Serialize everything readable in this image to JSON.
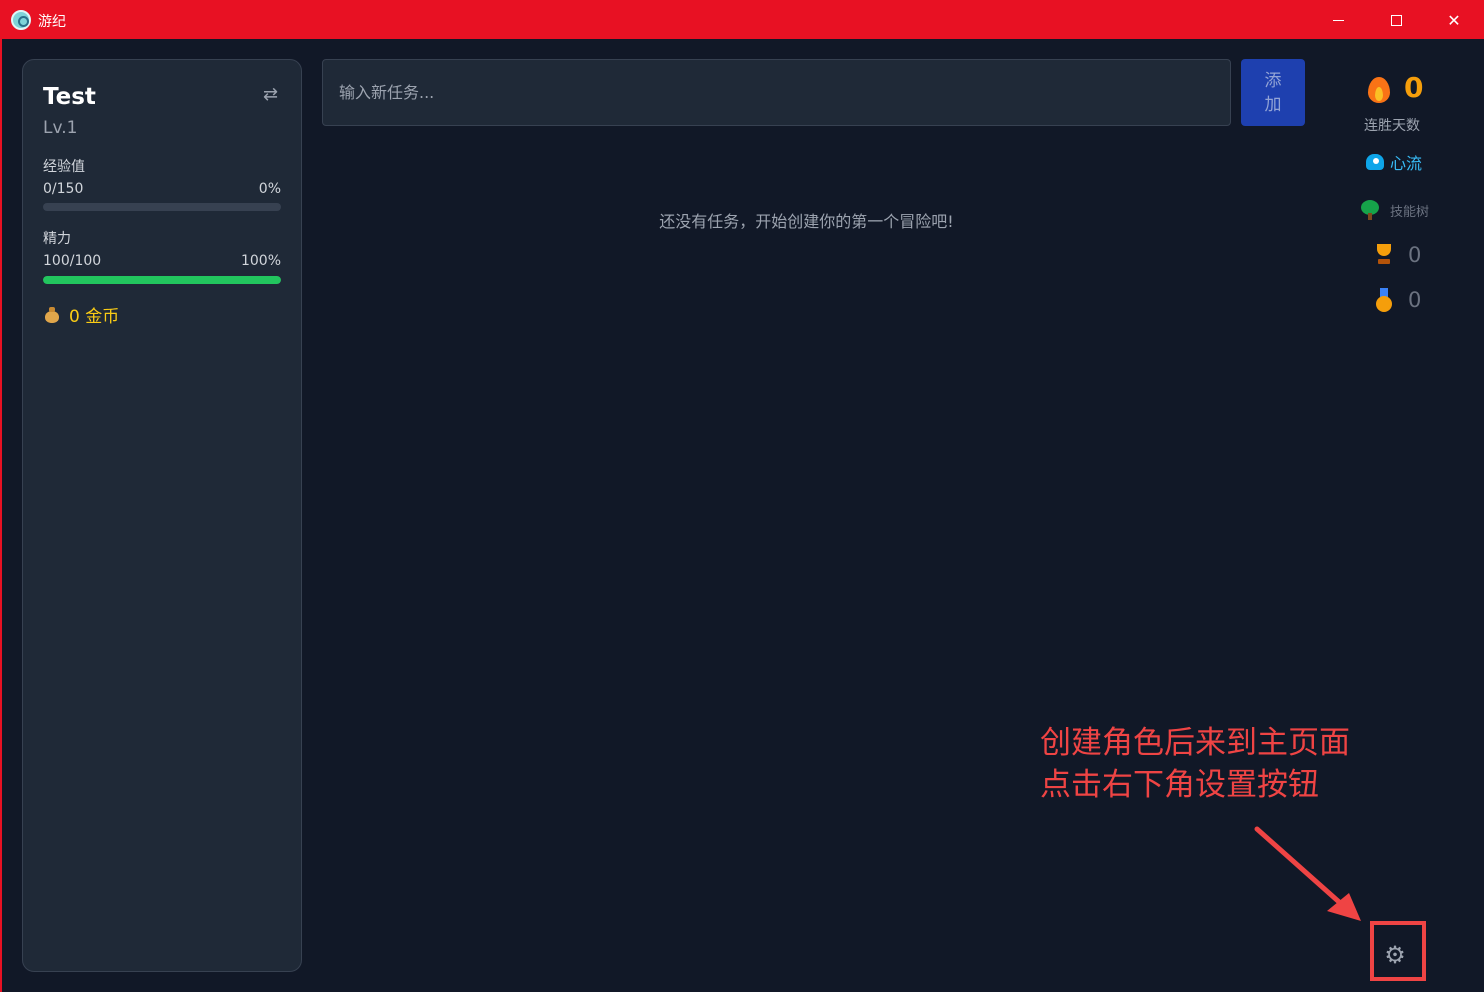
{
  "window": {
    "title": "游纪",
    "controls": {
      "minimize": "minimize",
      "maximize": "maximize",
      "close": "close"
    }
  },
  "sidebar": {
    "player_name": "Test",
    "level": "Lv.1",
    "experience": {
      "label": "经验值",
      "value": "0/150",
      "percent": "0%",
      "fill": 0
    },
    "energy": {
      "label": "精力",
      "value": "100/100",
      "percent": "100%",
      "fill": 1
    },
    "coins": "0 金币"
  },
  "main": {
    "task_input_placeholder": "输入新任务...",
    "add_button": "添加",
    "empty_message": "还没有任务，开始创建你的第一个冒险吧!"
  },
  "right_panel": {
    "streak_count": "0",
    "streak_label": "连胜天数",
    "flow_link": "心流",
    "skill_tree_link": "技能树",
    "trophy_count": "0",
    "medal_count": "0"
  },
  "annotation": {
    "line1": "创建角色后来到主页面",
    "line2": "点击右下角设置按钮"
  },
  "colors": {
    "titlebar": "#e81123",
    "background": "#111827",
    "card": "#1f2937",
    "energy_bar": "#22c55e",
    "coins": "#facc15",
    "streak": "#f59e0b",
    "flow": "#38bdf8",
    "annotation": "#ef4444"
  }
}
